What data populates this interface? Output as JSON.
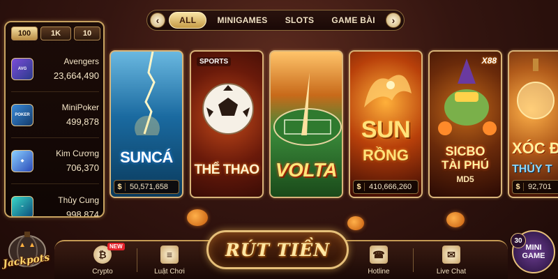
{
  "tabs": {
    "items": [
      "ALL",
      "MINIGAMES",
      "SLOTS",
      "GAME BÀI"
    ],
    "active": "ALL",
    "prev_icon": "chevron-left-icon",
    "next_icon": "chevron-right-icon"
  },
  "jackpot": {
    "denominations": [
      "100",
      "1K",
      "10"
    ],
    "selected": "100",
    "items": [
      {
        "name": "Avengers",
        "amount": "23,664,490"
      },
      {
        "name": "MiniPoker",
        "amount": "499,878"
      },
      {
        "name": "Kim Cương",
        "amount": "706,370"
      },
      {
        "name": "Thủy Cung",
        "amount": "998,874"
      }
    ],
    "badge_label": "Jackpots"
  },
  "games": [
    {
      "title": "SUNCÁ",
      "jackpot": "50,571,658",
      "currency": "$"
    },
    {
      "title": "THỂ THAO",
      "tag": "SPORTS"
    },
    {
      "title": "VOLTA"
    },
    {
      "title": "SUN",
      "title2": "RỒNG",
      "jackpot": "410,666,260",
      "currency": "$"
    },
    {
      "title": "SICBO",
      "title2": "TÀI PHÚ",
      "title3": "MD5",
      "tag": "X88"
    },
    {
      "title": "XÓC Đ",
      "title2": "THỦY T",
      "jackpot": "92,701",
      "currency": "$"
    }
  ],
  "bottom_nav": {
    "crypto": {
      "label": "Crypto",
      "badge": "NEW",
      "icon": "bitcoin-icon"
    },
    "rules": {
      "label": "Luật Chơi",
      "icon": "rulebook-icon"
    },
    "withdraw": {
      "label": "RÚT TIỀN"
    },
    "hotline": {
      "label": "Hotline",
      "icon": "phone-icon"
    },
    "live_chat": {
      "label": "Live Chat",
      "icon": "chat-icon"
    }
  },
  "mini_game": {
    "count": "30",
    "label_line1": "MINI",
    "label_line2": "GAME"
  },
  "colors": {
    "accent_gold": "#d9b57a",
    "background": "#341510",
    "new_badge": "#e4222b"
  }
}
